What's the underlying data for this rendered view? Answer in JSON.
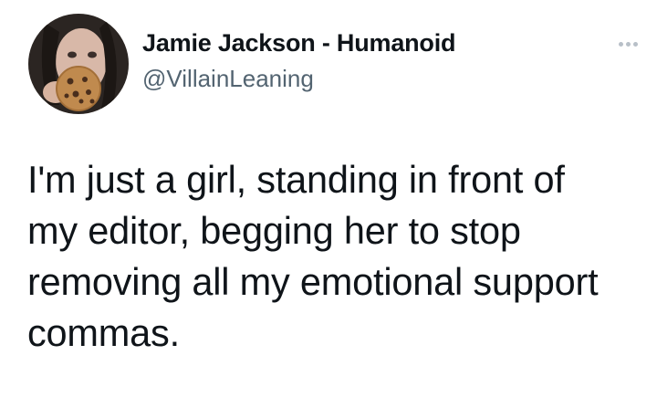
{
  "tweet": {
    "author": {
      "display_name": "Jamie Jackson - Humanoid",
      "handle": "@VillainLeaning",
      "avatar_icon": "avatar-photo-cookie"
    },
    "more_icon": "more-options-icon",
    "text": "I'm just a girl, standing in front of\nmy editor, begging her to stop\nremoving all my emotional support\ncommas."
  },
  "colors": {
    "text_primary": "#0f1419",
    "text_secondary": "#536471",
    "background": "#ffffff"
  }
}
